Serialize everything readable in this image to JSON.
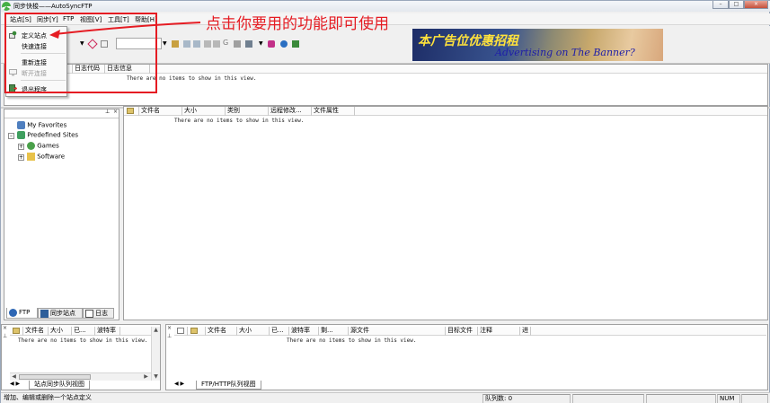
{
  "window": {
    "title": "同步快梭——AutoSyncFTP",
    "controls": [
      "–",
      "□",
      "×"
    ]
  },
  "menu": {
    "items": [
      "站点[S]",
      "同步[Y]",
      "FTP",
      "视图[V]",
      "工具[T]",
      "帮助[H]"
    ]
  },
  "site_menu": {
    "items": [
      {
        "label": "定义站点",
        "icon": "site-define-icon",
        "disabled": false
      },
      {
        "label": "快速连接",
        "icon": "",
        "disabled": false
      },
      {
        "label": "重新连接",
        "icon": "",
        "disabled": false
      },
      {
        "label": "断开连接",
        "icon": "disconnect-icon",
        "disabled": true
      },
      {
        "label": "退出程序",
        "icon": "exit-icon",
        "disabled": false
      }
    ]
  },
  "banner": {
    "headline": "本广告位优惠招租",
    "tagline": "Advertising on The Banner?"
  },
  "annotation": {
    "text": "点击你要用的功能即可使用",
    "color": "#e51c23"
  },
  "log": {
    "columns": [
      "",
      "日志代码",
      "日志信息"
    ],
    "empty_text": "There are no items to show in this view."
  },
  "tree": {
    "items": [
      {
        "label": "My Favorites",
        "icon": "favorites-icon",
        "expander": ""
      },
      {
        "label": "Predefined Sites",
        "icon": "sites-icon",
        "expander": "–"
      },
      {
        "label": "Games",
        "icon": "globe-icon",
        "expander": "+"
      },
      {
        "label": "Software",
        "icon": "folder-icon",
        "expander": "+"
      }
    ],
    "tabs": [
      "FTP",
      "同步站点",
      "日志"
    ]
  },
  "file_list": {
    "columns": [
      "",
      "文件名",
      "大小",
      "类别",
      "远程修改...",
      "文件属性"
    ],
    "empty_text": "There are no items to show in this view."
  },
  "sync_queue": {
    "columns": [
      "",
      "文件名",
      "大小",
      "已...",
      "波特率"
    ],
    "empty_text": "There are no items to show in this view.",
    "tab": "站点同步队列视图"
  },
  "ftp_queue": {
    "columns": [
      "",
      "文件名",
      "大小",
      "已...",
      "波特率",
      "剩...",
      "源文件",
      "目标文件",
      "注释",
      "进"
    ],
    "empty_text": "There are no items to show in this view.",
    "tab": "FTP/HTTP队列视图"
  },
  "status": {
    "message": "增加、编辑或删除一个站点定义",
    "queue": "队列数: 0",
    "num": "NUM"
  }
}
